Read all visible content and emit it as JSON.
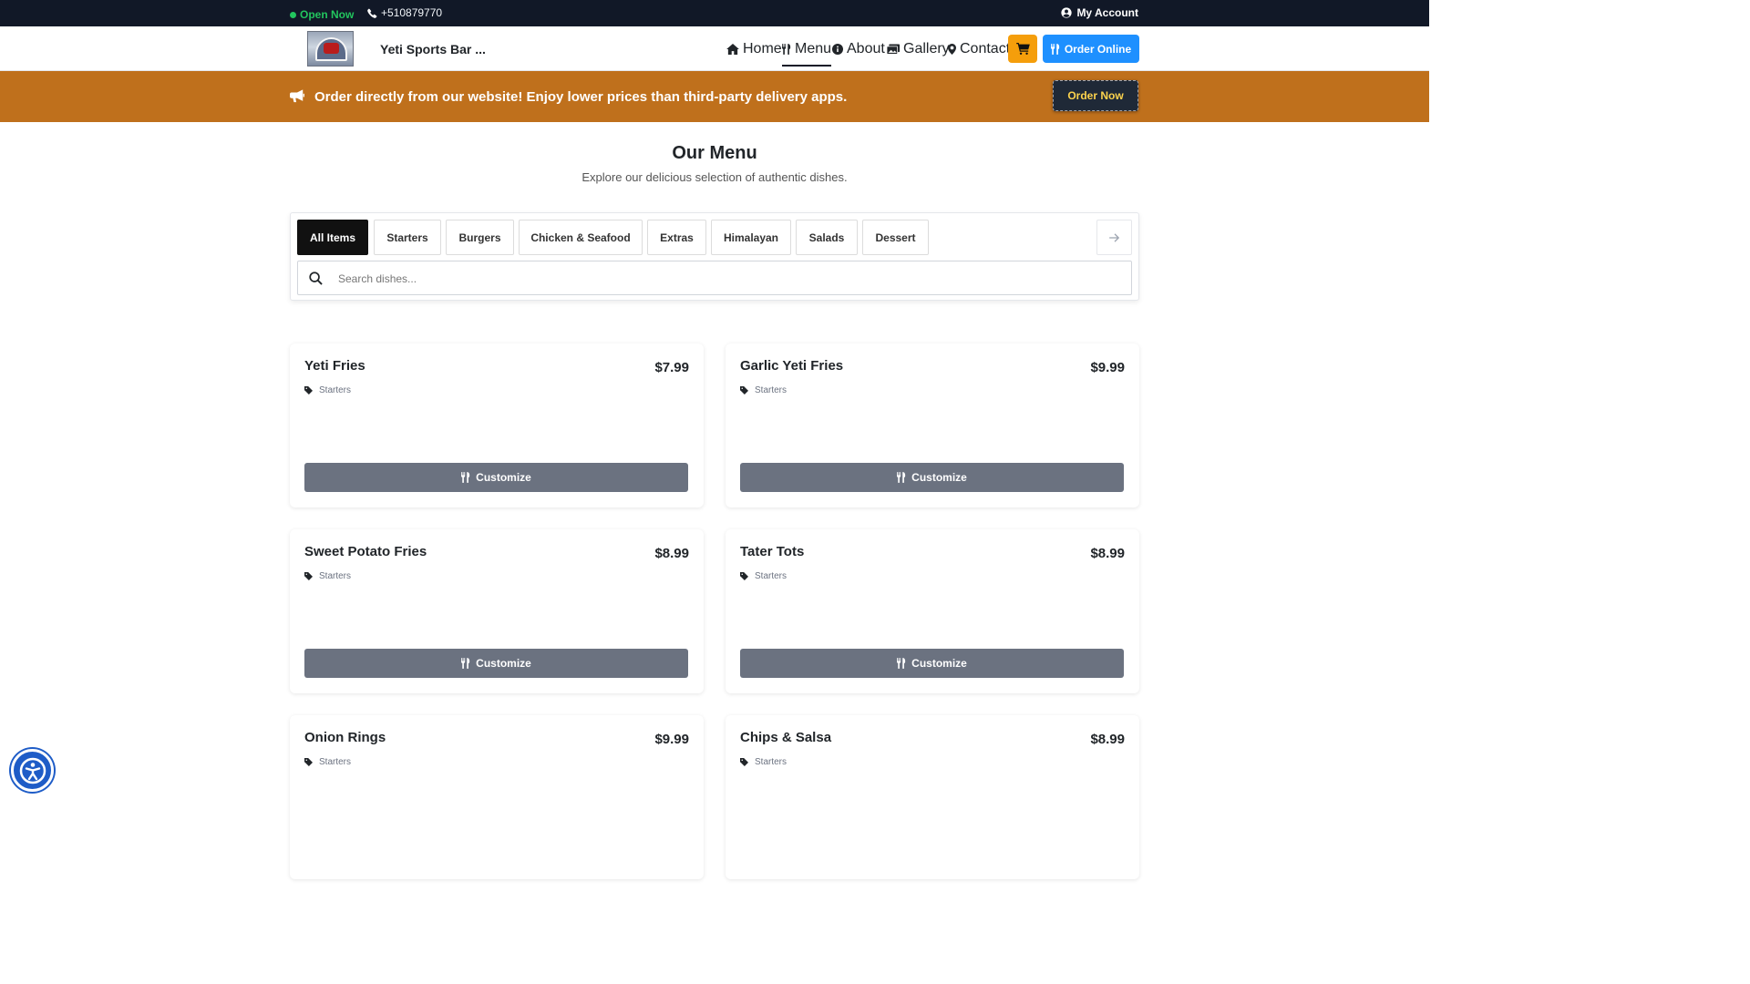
{
  "topbar": {
    "status": "Open Now",
    "phone": "+510879770",
    "account": "My Account"
  },
  "header": {
    "brand": "Yeti Sports Bar ...",
    "nav": [
      {
        "label": "Home",
        "icon": "home-icon"
      },
      {
        "label": "Menu",
        "icon": "utensils-icon",
        "active": true
      },
      {
        "label": "About",
        "icon": "info-icon"
      },
      {
        "label": "Gallery",
        "icon": "images-icon"
      },
      {
        "label": "Contact",
        "icon": "map-pin-icon"
      }
    ],
    "order_online": "Order Online"
  },
  "promo": {
    "text": "Order directly from our website! Enjoy lower prices than third-party delivery apps.",
    "button": "Order Now"
  },
  "menu": {
    "title": "Our Menu",
    "subtitle": "Explore our delicious selection of authentic dishes.",
    "tabs": [
      "All Items",
      "Starters",
      "Burgers",
      "Chicken & Seafood",
      "Extras",
      "Himalayan",
      "Salads",
      "Dessert"
    ],
    "active_tab": "All Items",
    "search_placeholder": "Search dishes...",
    "customize_label": "Customize",
    "items": [
      {
        "name": "Yeti Fries",
        "price": "$7.99",
        "category": "Starters"
      },
      {
        "name": "Garlic Yeti Fries",
        "price": "$9.99",
        "category": "Starters"
      },
      {
        "name": "Sweet Potato Fries",
        "price": "$8.99",
        "category": "Starters"
      },
      {
        "name": "Tater Tots",
        "price": "$8.99",
        "category": "Starters"
      },
      {
        "name": "Onion Rings",
        "price": "$9.99",
        "category": "Starters"
      },
      {
        "name": "Chips & Salsa",
        "price": "$8.99",
        "category": "Starters"
      }
    ]
  },
  "colors": {
    "topbar_bg": "#111827",
    "open_green": "#22c55e",
    "promo_bg": "#bf701c",
    "order_online_blue": "#1e90ff",
    "cart_orange": "#f59e0b",
    "customize_gray": "#6b7280",
    "accessibility_blue": "#1e5cc7"
  }
}
